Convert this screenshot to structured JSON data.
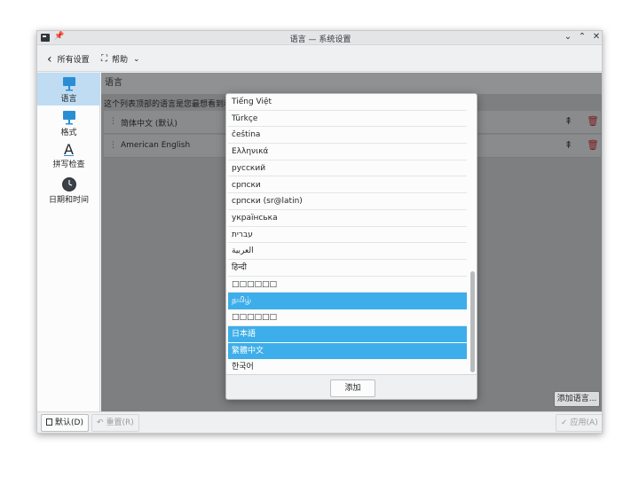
{
  "window": {
    "title": "语言 — 系统设置",
    "controls": {
      "pin": "📌",
      "collapse": "⌄",
      "maximize": "⌃",
      "close": "✕"
    }
  },
  "toolbar": {
    "back_icon": "‹",
    "back_label": "所有设置",
    "help_icon": "⛶",
    "help_label": "帮助",
    "help_arrow": "⌄"
  },
  "sidebar": {
    "items": [
      {
        "label": "语言",
        "icon": "language-icon",
        "selected": true
      },
      {
        "label": "格式",
        "icon": "formats-icon",
        "selected": false
      },
      {
        "label": "拼写检查",
        "icon": "spellcheck-icon",
        "glyph": "A",
        "selected": false
      },
      {
        "label": "日期和时间",
        "icon": "clock-icon",
        "selected": false
      }
    ]
  },
  "content": {
    "title": "语言",
    "description": "这个列表顶部的语言是您最想看到和",
    "languages": [
      {
        "name": "简体中文 (默认)",
        "grip": "⋮",
        "up": "⇞",
        "delete": "🗑"
      },
      {
        "name": "American English",
        "grip": "⋮",
        "up": "⇞",
        "delete": "🗑"
      }
    ],
    "add_language_button": "添加语言..."
  },
  "popup": {
    "items": [
      {
        "label": "Tiếng Việt",
        "selected": false
      },
      {
        "label": "Türkçe",
        "selected": false
      },
      {
        "label": "čeština",
        "selected": false
      },
      {
        "label": "Ελληνικά",
        "selected": false
      },
      {
        "label": "русский",
        "selected": false
      },
      {
        "label": "српски",
        "selected": false
      },
      {
        "label": "српски (sr@latin)",
        "selected": false
      },
      {
        "label": "українська",
        "selected": false
      },
      {
        "label": "עברית",
        "selected": false
      },
      {
        "label": "العربية",
        "selected": false
      },
      {
        "label": "हिन्दी",
        "selected": false
      },
      {
        "label": "□□□□□□",
        "selected": false
      },
      {
        "label": "தமிழ்",
        "selected": true
      },
      {
        "label": "□□□□□□",
        "selected": false
      },
      {
        "label": "日本語",
        "selected": true
      },
      {
        "label": "繁體中文",
        "selected": true
      },
      {
        "label": "한국어",
        "selected": false
      }
    ],
    "add_button": "添加"
  },
  "bottombar": {
    "defaults_button": "默认(D)",
    "reset_button": "重置(R)",
    "apply_button": "应用(A)"
  },
  "colors": {
    "selection": "#3daee9",
    "sidebar_selection": "#bfdcf3",
    "dim_overlay": "#7e7f80"
  }
}
